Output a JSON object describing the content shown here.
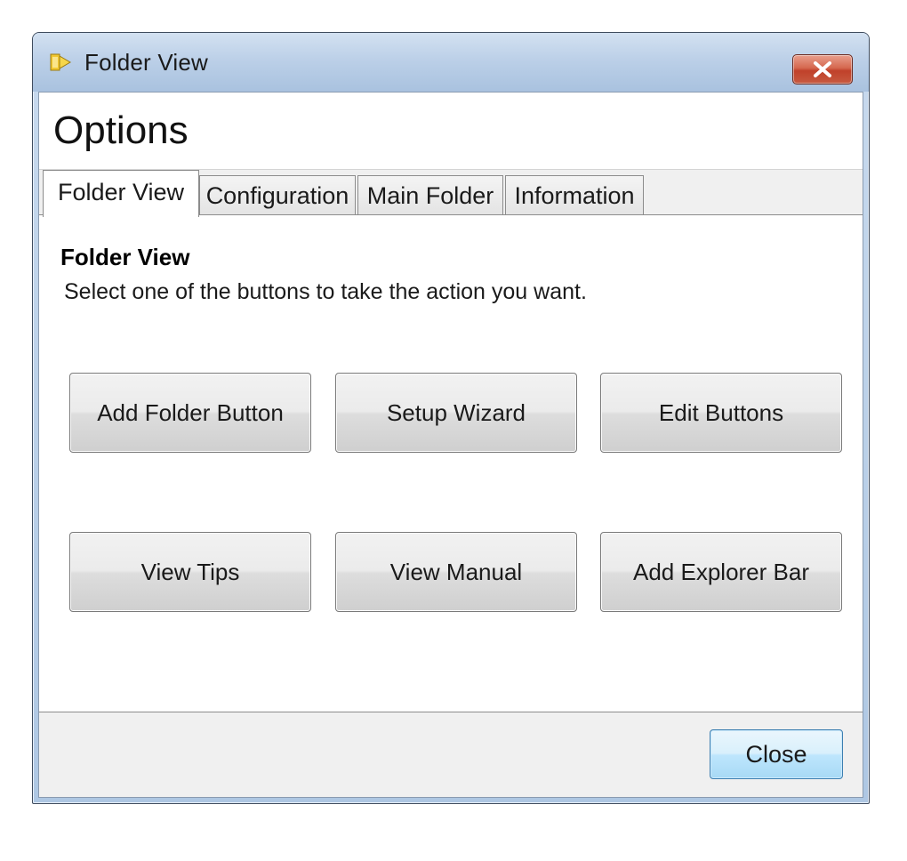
{
  "window": {
    "title": "Folder View",
    "icon": "folder-arrow-icon",
    "close_icon": "close-x-icon"
  },
  "header": {
    "title": "Options"
  },
  "tabs": [
    {
      "label": "Folder View",
      "active": true
    },
    {
      "label": "Configuration",
      "active": false
    },
    {
      "label": "Main Folder",
      "active": false
    },
    {
      "label": "Information",
      "active": false
    }
  ],
  "panel": {
    "heading": "Folder View",
    "description": "Select one of the buttons to take the action you want.",
    "buttons": [
      {
        "label": "Add Folder Button"
      },
      {
        "label": "Setup Wizard"
      },
      {
        "label": "Edit Buttons"
      },
      {
        "label": "View Tips"
      },
      {
        "label": "View Manual"
      },
      {
        "label": "Add Explorer Bar"
      }
    ]
  },
  "footer": {
    "close_label": "Close"
  },
  "colors": {
    "titlebar": "#bcd0e8",
    "close_button": "#c75a40",
    "default_button": "#bee6fd",
    "icon_gold": "#e0b020"
  }
}
